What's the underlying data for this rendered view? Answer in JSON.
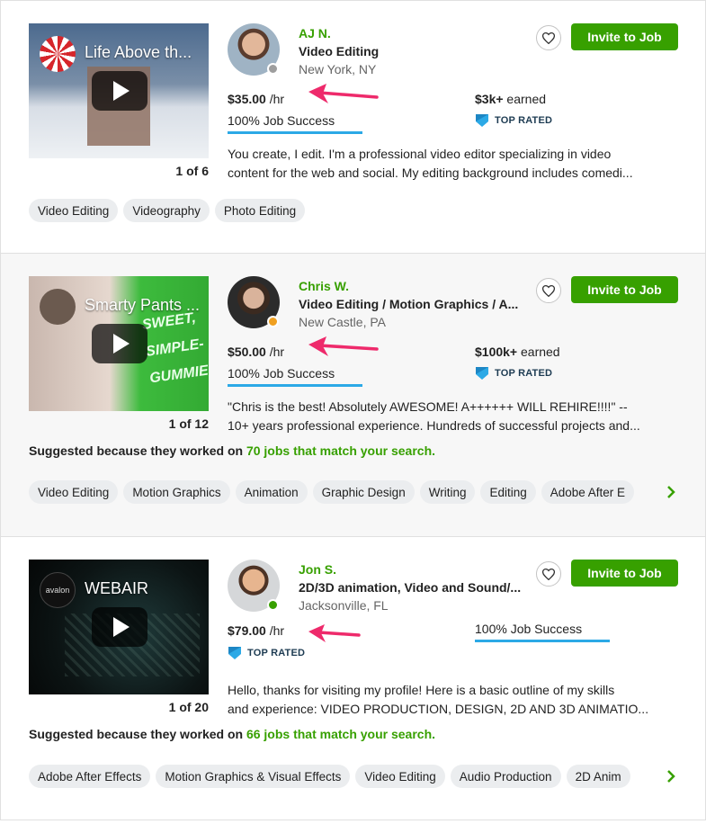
{
  "colors": {
    "brand_green": "#37a000",
    "success_blue": "#2ca9e6",
    "arrow_pink": "#ee2a6b",
    "top_rated_navy": "#1d3b52"
  },
  "invite_label": "Invite to Job",
  "top_rated_label": "TOP RATED",
  "suggested_prefix": "Suggested because they worked on",
  "freelancers": [
    {
      "video_title": "Life Above th...",
      "video_counter": "1 of 6",
      "name": "AJ N.",
      "title": "Video Editing",
      "location": "New York, NY",
      "status": "offline",
      "rate": "$35.00",
      "rate_unit": " /hr",
      "job_success": "100% Job Success",
      "job_success_percent": 100,
      "earned": "$3k+",
      "earned_suffix": " earned",
      "top_rated": true,
      "description": [
        "You create, I edit. I'm a professional video editor specializing in video",
        "content for the web and social. My editing background includes comedi..."
      ],
      "skills": [
        "Video Editing",
        "Videography",
        "Photo Editing"
      ]
    },
    {
      "video_title": "Smarty Pants ...",
      "video_deco": "SWEET, SIMPLE- GUMMIES",
      "video_counter": "1 of 12",
      "name": "Chris W.",
      "title": "Video Editing / Motion Graphics / A...",
      "location": "New Castle, PA",
      "status": "away",
      "rate": "$50.00",
      "rate_unit": " /hr",
      "job_success": "100% Job Success",
      "job_success_percent": 100,
      "earned": "$100k+",
      "earned_suffix": " earned",
      "top_rated": true,
      "description": [
        "\"Chris is the best! Absolutely AWESOME! A++++++ WILL REHIRE!!!!\" --",
        "10+ years professional experience. Hundreds of successful projects and..."
      ],
      "suggested_link": "70 jobs that match your search.",
      "skills": [
        "Video Editing",
        "Motion Graphics",
        "Animation",
        "Graphic Design",
        "Writing",
        "Editing",
        "Adobe After E"
      ]
    },
    {
      "video_title": "WEBAIR",
      "video_badge": "avalon",
      "video_counter": "1 of 20",
      "name": "Jon S.",
      "title": "2D/3D animation, Video and Sound/...",
      "location": "Jacksonville, FL",
      "status": "online",
      "rate": "$79.00",
      "rate_unit": " /hr",
      "job_success": "100% Job Success",
      "job_success_percent": 100,
      "top_rated": true,
      "description": [
        "Hello, thanks for visiting my profile! Here is a basic outline of my skills",
        "and experience: VIDEO PRODUCTION, DESIGN, 2D AND 3D ANIMATIO..."
      ],
      "suggested_link": "66 jobs that match your search.",
      "skills": [
        "Adobe After Effects",
        "Motion Graphics & Visual Effects",
        "Video Editing",
        "Audio Production",
        "2D Anim"
      ]
    }
  ]
}
